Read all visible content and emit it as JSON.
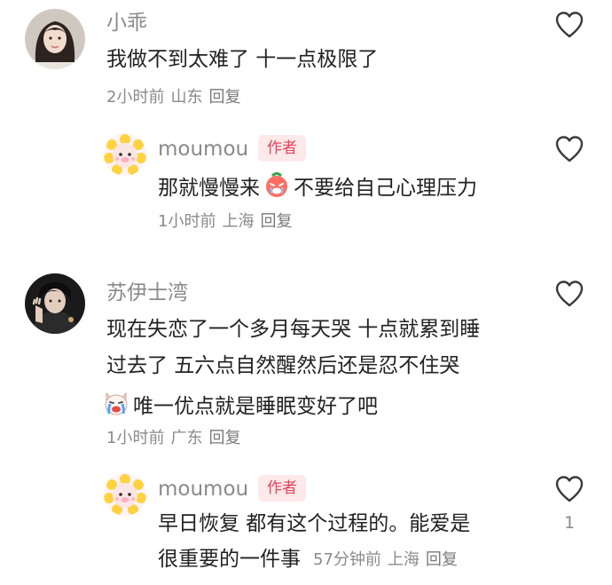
{
  "comments": [
    {
      "username": "小乖",
      "content": "我做不到太难了 十一点极限了",
      "time": "2小时前",
      "location": "山东",
      "reply_label": "回复"
    },
    {
      "username": "moumou",
      "author_tag": "作者",
      "content_before_emoji": "那就慢慢来",
      "emoji": "crying-face-emoji",
      "content_after_emoji": "不要给自己心理压力",
      "time": "1小时前",
      "location": "上海",
      "reply_label": "回复"
    },
    {
      "username": "苏伊士湾",
      "content_lines": [
        "现在失恋了一个多月每天哭 十点就累到睡",
        "过去了 五六点自然醒然后还是忍不住哭",
        "唯一优点就是睡眠变好了吧"
      ],
      "emoji": "crying-dog-emoji",
      "time": "1小时前",
      "location": "广东",
      "reply_label": "回复"
    },
    {
      "username": "moumou",
      "author_tag": "作者",
      "content_lines": [
        "早日恢复 都有这个过程的。能爱是",
        "很重要的一件事"
      ],
      "time": "57分钟前",
      "location": "上海",
      "reply_label": "回复",
      "like_count": "1"
    }
  ],
  "icons": {
    "like": "heart-outline-icon"
  },
  "colors": {
    "author_tag_bg": "#fde8ea",
    "author_tag_text": "#e8435a",
    "secondary_text": "#8a8a8a"
  }
}
